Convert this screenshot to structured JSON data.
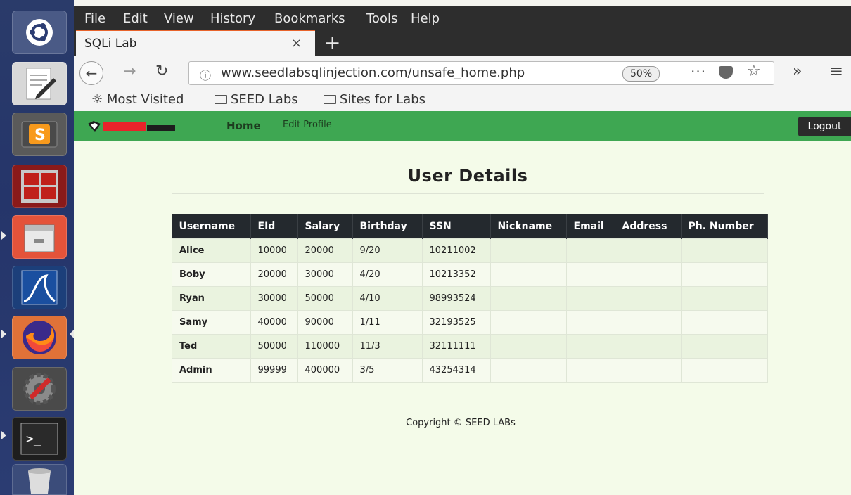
{
  "launcher": {
    "items": [
      "ubuntu-dash-icon",
      "text-editor-icon",
      "sublime-text-icon",
      "terminal-multiplexer-icon",
      "file-manager-icon",
      "wireshark-icon",
      "firefox-icon",
      "system-settings-icon",
      "terminal-icon",
      "trash-icon"
    ]
  },
  "menubar": {
    "file": "File",
    "edit": "Edit",
    "view": "View",
    "history": "History",
    "bookmarks": "Bookmarks",
    "tools": "Tools",
    "help": "Help"
  },
  "tab": {
    "title": "SQLi Lab",
    "close": "×",
    "new_tab": "+"
  },
  "toolbar": {
    "url": "www.seedlabsqlinjection.com/unsafe_home.php",
    "zoom": "50%",
    "dots": "···",
    "overflow": "»",
    "menu": "≡"
  },
  "bookmarks_bar": {
    "most_visited": "Most Visited",
    "seed_labs": "SEED Labs",
    "sites_for_labs": "Sites for Labs"
  },
  "site": {
    "nav": {
      "home": "Home",
      "edit_profile": "Edit Profile",
      "logout": "Logout"
    },
    "heading": "User Details",
    "columns": [
      "Username",
      "EId",
      "Salary",
      "Birthday",
      "SSN",
      "Nickname",
      "Email",
      "Address",
      "Ph. Number"
    ],
    "rows": [
      [
        "Alice",
        "10000",
        "20000",
        "9/20",
        "10211002",
        "",
        "",
        "",
        ""
      ],
      [
        "Boby",
        "20000",
        "30000",
        "4/20",
        "10213352",
        "",
        "",
        "",
        ""
      ],
      [
        "Ryan",
        "30000",
        "50000",
        "4/10",
        "98993524",
        "",
        "",
        "",
        ""
      ],
      [
        "Samy",
        "40000",
        "90000",
        "1/11",
        "32193525",
        "",
        "",
        "",
        ""
      ],
      [
        "Ted",
        "50000",
        "110000",
        "11/3",
        "32111111",
        "",
        "",
        "",
        ""
      ],
      [
        "Admin",
        "99999",
        "400000",
        "3/5",
        "43254314",
        "",
        "",
        "",
        ""
      ]
    ],
    "copyright": "Copyright © SEED LABs"
  },
  "colors": {
    "site_nav": "#3ea752",
    "page_bg": "#f4fbe9",
    "table_header": "#24292e",
    "tab_accent": "#e8632b",
    "launcher": "#2a3b6a"
  }
}
